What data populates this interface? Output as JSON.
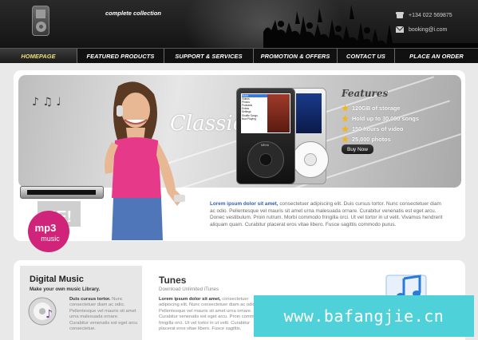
{
  "header": {
    "tagline": "complete collection",
    "phone": "+134 022 569875",
    "email": "booking@i.com"
  },
  "nav": {
    "items": [
      {
        "label": "HOMEPAGE",
        "active": true
      },
      {
        "label": "FEATURED PRODUCTS",
        "active": false
      },
      {
        "label": "SUPPORT & SERVICES",
        "active": false
      },
      {
        "label": "PROMOTION & OFFERS",
        "active": false
      },
      {
        "label": "CONTACT US",
        "active": false
      },
      {
        "label": "PLACE AN ORDER",
        "active": false
      }
    ]
  },
  "banner": {
    "classic_text": "Classic",
    "features_title": "Features",
    "features": [
      "120GB of storage",
      "Hold up to 30,000 songs",
      "150 hours of video",
      "25,000 photos"
    ],
    "buy_now": "Buy Now",
    "ipod_menu": [
      "Music",
      "Videos",
      "Photos",
      "Podcasts",
      "Extras",
      "Settings",
      "Shuffle Songs",
      "Now Playing"
    ],
    "mp3_label": "mp3",
    "music_label": "music"
  },
  "intro": {
    "lead": "Lorem ipsum dolor sit amet,",
    "body": " consectetuer adipiscing elit. Duis cursus tortor. Nunc consectetuer diam ac odio. Pellentesque vel mauris sit amet urna malesuada ornare. Curabitur venenatis est eget arcu. Donec vestibulum. Proin rutrum. Morbi commodo fringilla orci. Ut vel tortor in ut velit. Vivamus hendrerit aliquam quam. Curabitur placerat eros vitae libero. Fusce sagittis commodo purus."
  },
  "digital_music": {
    "title": "Digital Music",
    "subtitle": "Make your own music Library.",
    "lead": "Duis cursus tortor.",
    "body": " Nunc consectetuer diam ac odio. Pellentesque vel mauris sit amet urna malesuada ornare. Curabitur venenatis est eget arcu consectetue."
  },
  "tunes": {
    "title": "Tunes",
    "subtitle": "Download Unlimited iTunes",
    "lead": "Lorem ipsum dolor sit amet,",
    "body": " consectetuer adipiscing elit. Nunc consectetuer diam ac odio. Pellentesque vel mauris sit amet urna ornare. Curabitur venenatis est eget arcu. Proin commodo fringilla orci. Ut vel tortor in ut velit. Curabitur placerat eros vitae libero. Fusce sagittis."
  },
  "watermark": "www.bafangjie.cn",
  "colors": {
    "nav_active": "#e8e07a",
    "link_blue": "#2f5fb2",
    "watermark_bg": "#4fd1d9",
    "mp3_pink": "#d0247a"
  },
  "icons": {
    "phone": "phone-icon",
    "email": "mail-icon",
    "star": "star-icon",
    "cd": "cd-icon"
  }
}
